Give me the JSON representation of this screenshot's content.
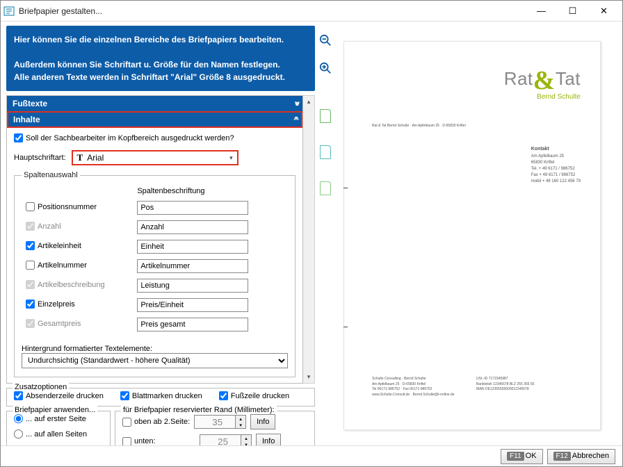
{
  "window": {
    "title": "Briefpapier gestalten...",
    "minimize": "—",
    "maximize": "☐",
    "close": "✕"
  },
  "info": {
    "line1": "Hier können Sie die einzelnen Bereiche des Briefpapiers bearbeiten.",
    "line2": "Außerdem können Sie Schriftart u. Größe für den Namen festlegen.",
    "line3": "Alle anderen Texte werden in Schriftart \"Arial\" Größe 8 ausgedruckt."
  },
  "sections": {
    "fusstexte": "Fußtexte",
    "inhalte": "Inhalte"
  },
  "inhalte": {
    "sachbearbeiter": {
      "label": "Soll der Sachbearbeiter im Kopfbereich ausgedruckt werden?",
      "checked": true
    },
    "hauptschrift_label": "Hauptschriftart:",
    "font_value": "Arial",
    "spalten_legend": "Spaltenauswahl",
    "besch_head": "Spaltenbeschriftung",
    "rows": [
      {
        "label": "Positionsnummer",
        "checked": false,
        "disabled": false,
        "value": "Pos"
      },
      {
        "label": "Anzahl",
        "checked": true,
        "disabled": true,
        "value": "Anzahl"
      },
      {
        "label": "Artikeleinheit",
        "checked": true,
        "disabled": false,
        "value": "Einheit"
      },
      {
        "label": "Artikelnummer",
        "checked": false,
        "disabled": false,
        "value": "Artikelnummer"
      },
      {
        "label": "Artikelbeschreibung",
        "checked": true,
        "disabled": true,
        "value": "Leistung"
      },
      {
        "label": "Einzelpreis",
        "checked": true,
        "disabled": false,
        "value": "Preis/Einheit"
      },
      {
        "label": "Gesamtpreis",
        "checked": true,
        "disabled": true,
        "value": "Preis gesamt"
      }
    ],
    "bg_label": "Hintergrund formatierter Textelemente:",
    "bg_value": "Undurchsichtig (Standardwert - höhere Qualität)"
  },
  "zusatz": {
    "legend": "Zusatzoptionen",
    "absender": {
      "label": "Absenderzeile drucken",
      "checked": true
    },
    "blatt": {
      "label": "Blattmarken drucken",
      "checked": true
    },
    "fuss": {
      "label": "Fußzeile drucken",
      "checked": true
    }
  },
  "anwenden": {
    "legend": "Briefpapier anwenden...",
    "erste": "... auf erster Seite",
    "alle": "... auf allen Seiten"
  },
  "rand": {
    "legend": "für Briefpapier reservierter Rand (Millimeter):",
    "oben_label": "oben ab 2.Seite:",
    "oben_value": "35",
    "unten_label": "unten:",
    "unten_value": "25",
    "info": "Info"
  },
  "preview": {
    "logo_pre": "Rat",
    "logo_post": "Tat",
    "logo_sub": "Bernd Schulte",
    "addr": "Rat & Tat Bernd Schulte · Am Apfelbaum 25 · D-65830 Kriftel",
    "kontakt": {
      "head": "Kontakt",
      "l1": "Am Apfelbaum 25",
      "l2": "65830 Kriftel",
      "l3": "Tel. + 49 6171 / 986752",
      "l4": "Fax + 49 6171 / 986752",
      "l5": "mobil + 49 160 122 456 79"
    },
    "ftr_a": [
      "Schulte Consulting · Bernd Schulte",
      "Am Apfelbaum 25 · D-65830 Kriftel",
      "Tel 06171-986752 · Fax 06171-986752",
      "www.Schulte-Consult.de · Bernd.Schulte@t-online.de"
    ],
    "ftr_b": [
      "USt.-ID 7172345987",
      "Bankleitzk 12345678 BLZ 255 355 55",
      "IBAN DE12355555500012345678"
    ]
  },
  "buttons": {
    "ok": "OK",
    "cancel": "Abbrechen",
    "f11": "F11",
    "f12": "F12"
  }
}
